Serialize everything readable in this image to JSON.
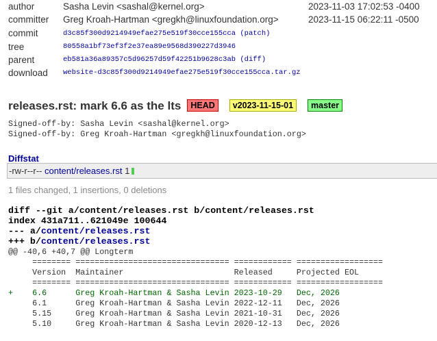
{
  "meta": {
    "author": {
      "label": "author",
      "value": "Sasha Levin <sashal@kernel.org>",
      "date": "2023-11-03 17:02:53 -0400"
    },
    "committer": {
      "label": "committer",
      "value": "Greg Kroah-Hartman <gregkh@linuxfoundation.org>",
      "date": "2023-11-15 06:22:11 -0500"
    },
    "commit": {
      "label": "commit",
      "hash": "d3c85f300d9214949efae275e519f30cce155cca",
      "link": "patch"
    },
    "tree": {
      "label": "tree",
      "hash": "80558a1bf73ef3f2e37ea89e9568d390227d3946"
    },
    "parent": {
      "label": "parent",
      "hash": "eb581a36a89357c5d96257d59f42251b9628c3ab",
      "link": "diff"
    },
    "download": {
      "label": "download",
      "file": "website-d3c85f300d9214949efae275e519f30cce155cca.tar.gz"
    }
  },
  "subject": "releases.rst: mark 6.6 as the lts",
  "badges": [
    {
      "label": "HEAD",
      "color": "#ff7777"
    },
    {
      "label": "v2023-11-15-01",
      "color": "#ffff77"
    },
    {
      "label": "master",
      "color": "#88ff88"
    }
  ],
  "message": [
    "Signed-off-by: Sasha Levin <sashal@kernel.org>",
    "Signed-off-by: Greg Kroah-Hartman <gregkh@linuxfoundation.org>"
  ],
  "diffstat": {
    "heading": "Diffstat",
    "mode": "-rw-r--r--",
    "file": "content/releases.rst",
    "count": "1",
    "summary": "1 files changed, 1 insertions, 0 deletions"
  },
  "diff": {
    "header": "diff --git a/content/releases.rst b/content/releases.rst",
    "index": "index 431a711..621049e 100644",
    "old_prefix": "--- a/",
    "old_file": "content/releases.rst",
    "new_prefix": "+++ b/",
    "new_file": "content/releases.rst",
    "hunk": "@@ -40,6 +40,7 @@ Longterm",
    "lines": [
      {
        "type": "ctx",
        "text": "     ======== ================================ ============ =================="
      },
      {
        "type": "ctx",
        "text": "     Version  Maintainer                       Released     Projected EOL"
      },
      {
        "type": "ctx",
        "text": "     ======== ================================ ============ =================="
      },
      {
        "type": "add",
        "text": "+    6.6      Greg Kroah-Hartman & Sasha Levin 2023-10-29   Dec, 2026"
      },
      {
        "type": "ctx",
        "text": "     6.1      Greg Kroah-Hartman & Sasha Levin 2022-12-11   Dec, 2026"
      },
      {
        "type": "ctx",
        "text": "     5.15     Greg Kroah-Hartman & Sasha Levin 2021-10-31   Dec, 2026"
      },
      {
        "type": "ctx",
        "text": "     5.10     Greg Kroah-Hartman & Sasha Levin 2020-12-13   Dec, 2026"
      }
    ]
  }
}
